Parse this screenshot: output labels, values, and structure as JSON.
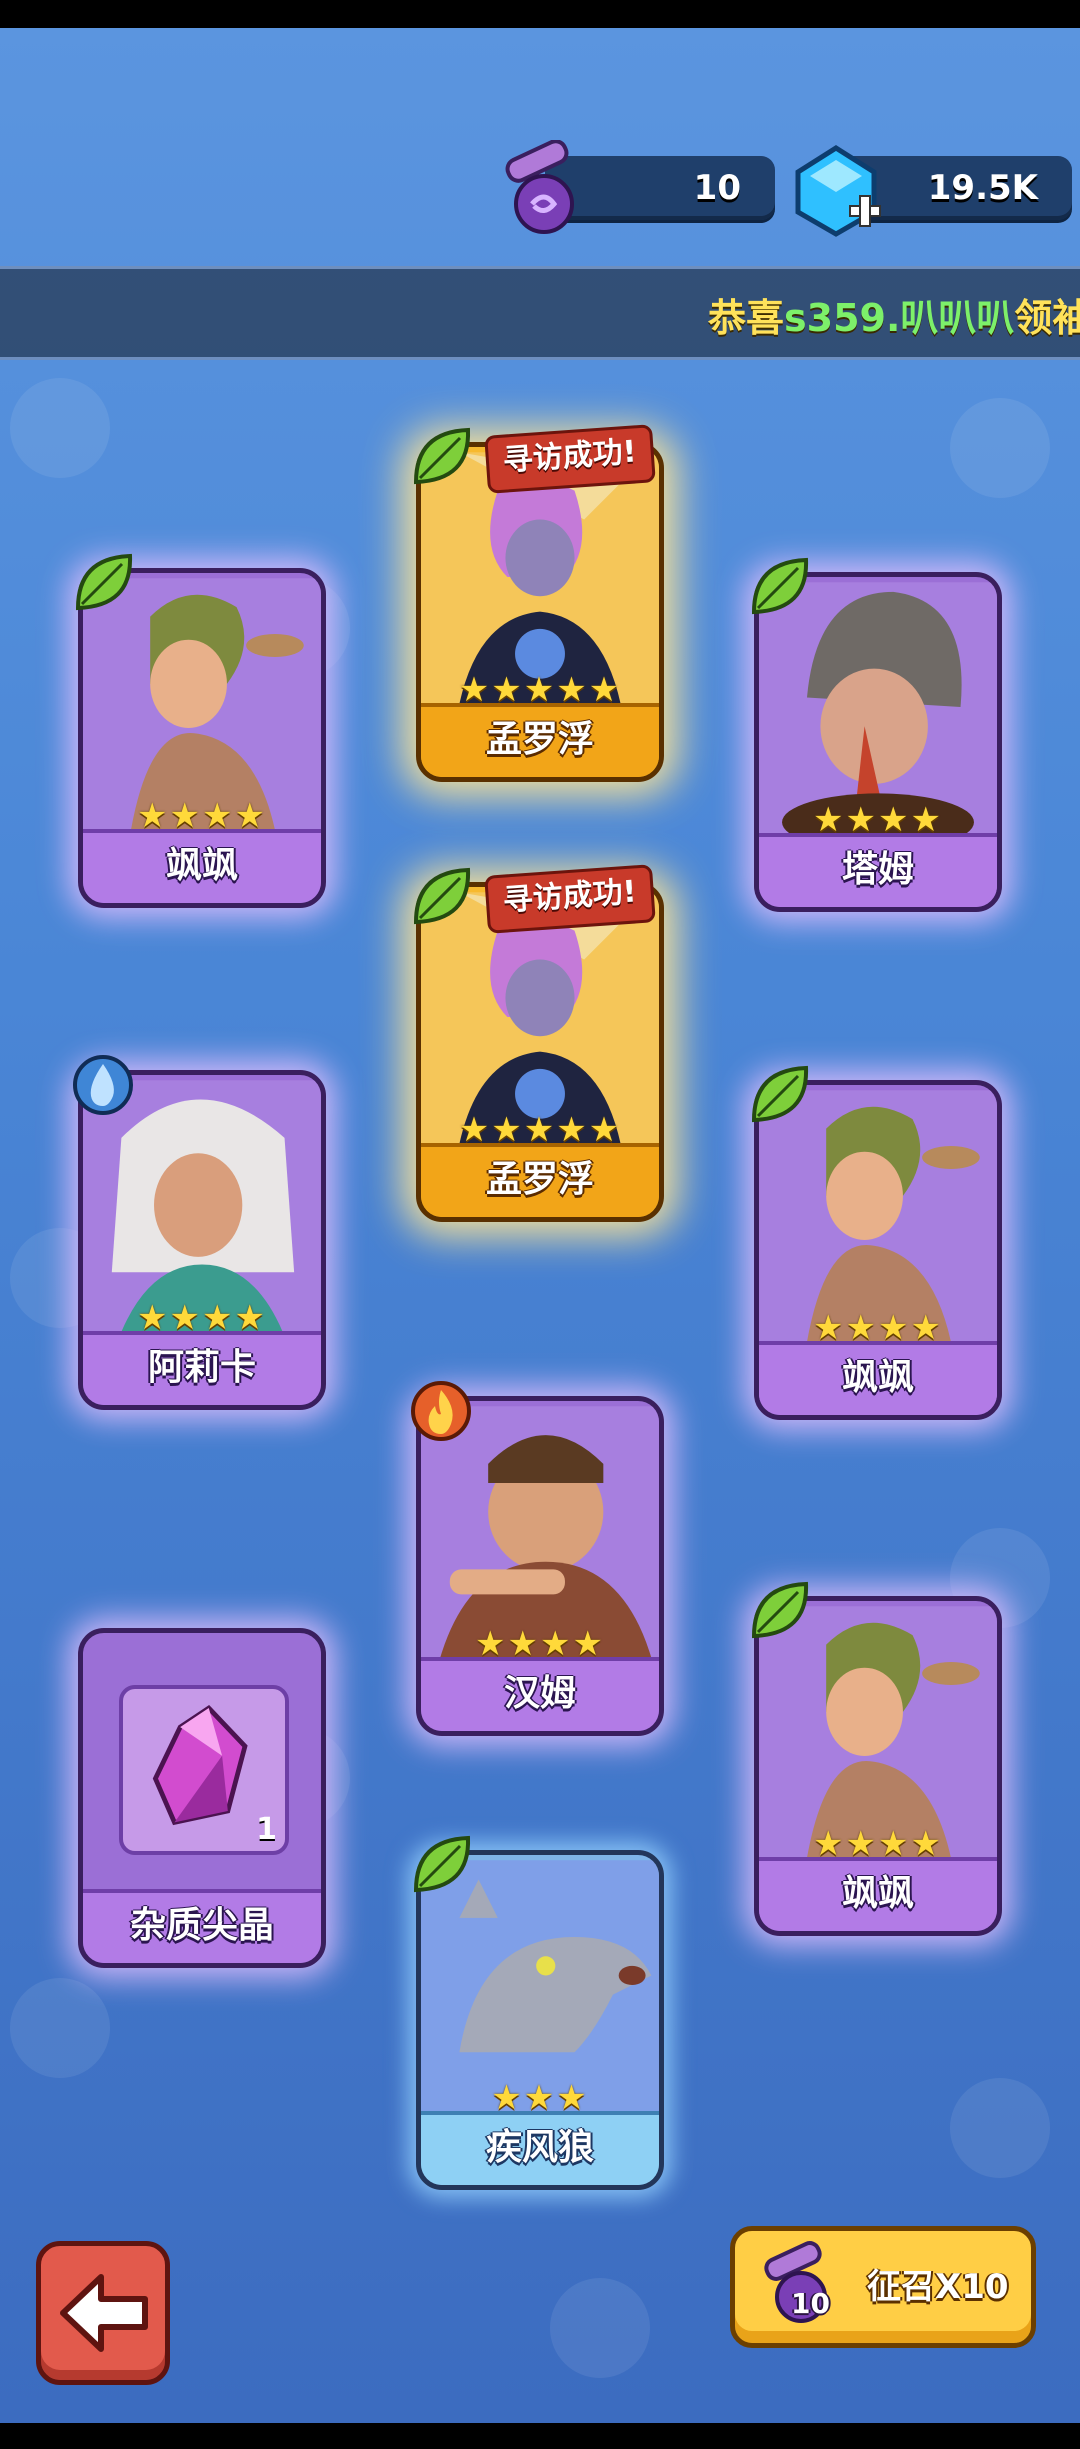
{
  "resources": {
    "scrolls": "10",
    "gems": "19.5K"
  },
  "marquee": {
    "prefix": "恭喜",
    "player": "s359.叭叭叭",
    "suffix": "领袖"
  },
  "cards": [
    {
      "name": "飒飒",
      "stars": "★★★★",
      "element": "leaf-icon",
      "rarity": "purple"
    },
    {
      "name": "孟罗浮",
      "stars": "★★★★★",
      "element": "leaf-icon",
      "rarity": "gold",
      "banner": "寻访成功!"
    },
    {
      "name": "塔姆",
      "stars": "★★★★",
      "element": "leaf-icon",
      "rarity": "purple"
    },
    {
      "name": "孟罗浮",
      "stars": "★★★★★",
      "element": "leaf-icon",
      "rarity": "gold",
      "banner": "寻访成功!"
    },
    {
      "name": "阿莉卡",
      "stars": "★★★★",
      "element": "water-icon",
      "rarity": "purple"
    },
    {
      "name": "飒飒",
      "stars": "★★★★",
      "element": "leaf-icon",
      "rarity": "purple"
    },
    {
      "name": "汉姆",
      "stars": "★★★★",
      "element": "fire-icon",
      "rarity": "purple"
    },
    {
      "name": "杂质尖晶",
      "count": "1",
      "rarity": "purple"
    },
    {
      "name": "飒飒",
      "stars": "★★★★",
      "element": "leaf-icon",
      "rarity": "purple"
    },
    {
      "name": "疾风狼",
      "stars": "★★★",
      "element": "leaf-icon",
      "rarity": "blue"
    }
  ],
  "buttons": {
    "summon_label": "征召X10",
    "summon_cost": "10"
  },
  "colors": {
    "background": "#4a86d6",
    "gold_card": "#f7b92e",
    "purple_card": "#9b6fd6",
    "blue_card": "#7fb4e8"
  }
}
